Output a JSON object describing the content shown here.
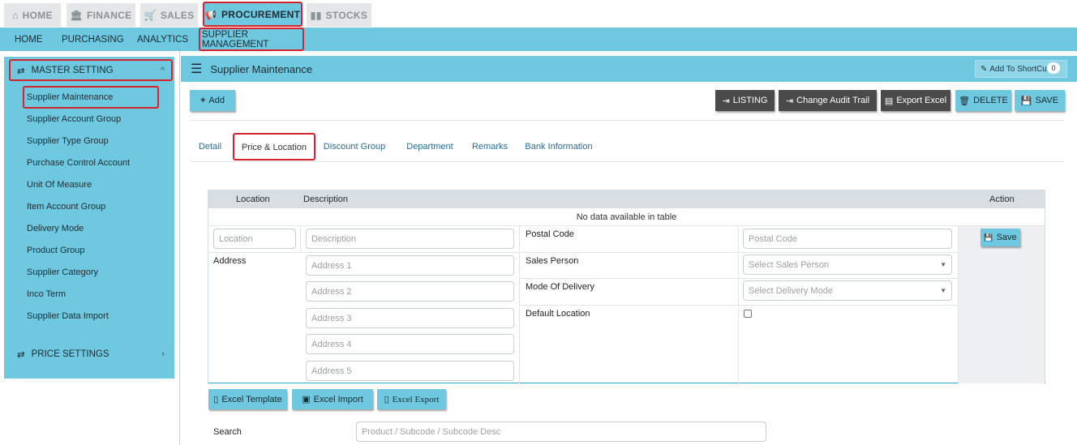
{
  "top_tabs": [
    {
      "label": "HOME",
      "icon": "home-icon"
    },
    {
      "label": "FINANCE",
      "icon": "bank-icon"
    },
    {
      "label": "SALES",
      "icon": "cart-icon"
    },
    {
      "label": "PROCUREMENT",
      "icon": "megaphone-icon"
    },
    {
      "label": "STOCKS",
      "icon": "bar-chart-icon"
    }
  ],
  "sub_nav": [
    "HOME",
    "PURCHASING",
    "ANALYTICS",
    "SUPPLIER MANAGEMENT"
  ],
  "sidebar": {
    "master_setting": "MASTER SETTING",
    "items": [
      "Supplier Maintenance",
      "Supplier Account Group",
      "Supplier Type Group",
      "Purchase Control Account",
      "Unit Of Measure",
      "Item Account Group",
      "Delivery Mode",
      "Product Group",
      "Supplier Category",
      "Inco Term",
      "Supplier Data Import"
    ],
    "price_settings": "PRICE SETTINGS"
  },
  "page": {
    "title": "Supplier Maintenance",
    "shortcut_label": "Add To ShortCut",
    "shortcut_count": "0"
  },
  "toolbar": {
    "add": "Add",
    "listing": "LISTING",
    "audit": "Change Audit Trail",
    "export": "Export Excel",
    "delete": "DELETE",
    "save": "SAVE"
  },
  "tabs": [
    "Detail",
    "Price & Location",
    "Discount Group",
    "Department",
    "Remarks",
    "Bank Information"
  ],
  "table": {
    "headers": {
      "location": "Location",
      "description": "Description",
      "action": "Action"
    },
    "empty": "No data available in table"
  },
  "form": {
    "location_ph": "Location",
    "description_ph": "Description",
    "postal_code_label": "Postal Code",
    "postal_code_ph": "Postal Code",
    "save": "Save",
    "address_label": "Address",
    "address_ph": [
      "Address 1",
      "Address 2",
      "Address 3",
      "Address 4",
      "Address 5"
    ],
    "sales_person_label": "Sales Person",
    "sales_person_ph": "Select Sales Person",
    "mode_delivery_label": "Mode Of Delivery",
    "mode_delivery_ph": "Select Delivery Mode",
    "default_location_label": "Default Location"
  },
  "excel": {
    "template": "Excel Template",
    "import": "Excel Import",
    "export": "Excel Export"
  },
  "search": {
    "label": "Search",
    "placeholder": "Product / Subcode / Subcode Desc"
  }
}
